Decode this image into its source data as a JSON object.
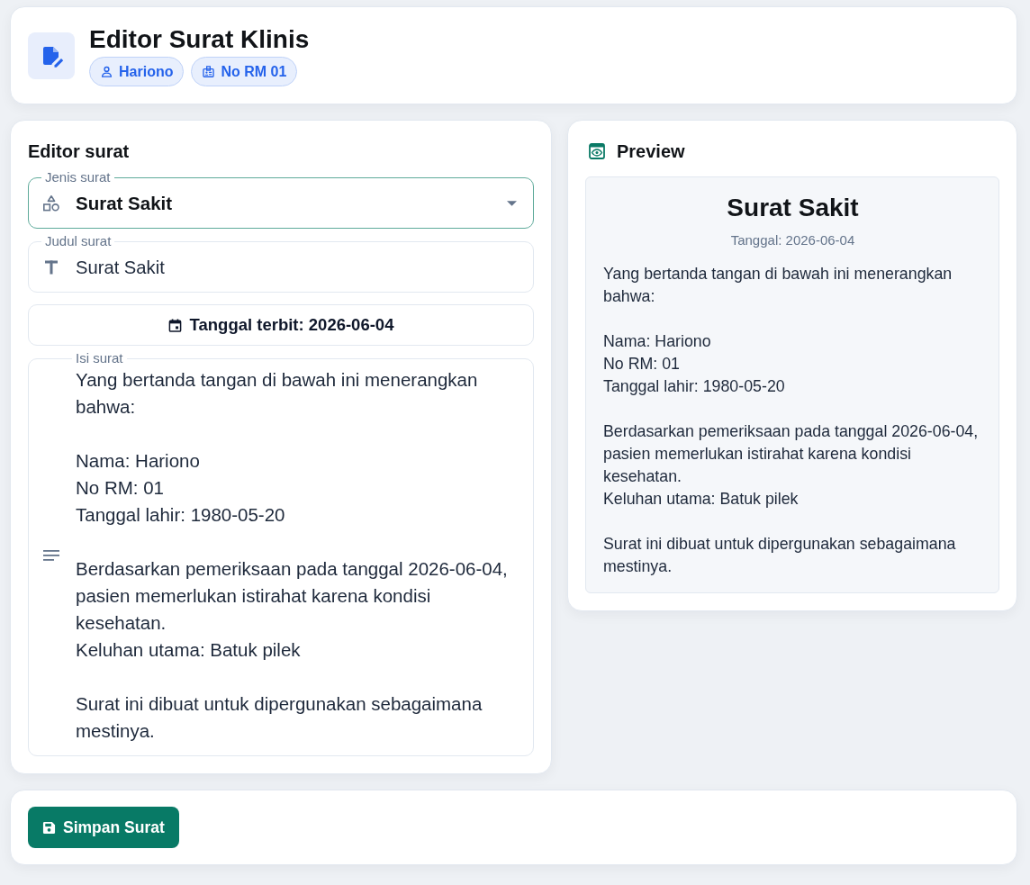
{
  "header": {
    "title": "Editor Surat Klinis",
    "chips": [
      {
        "kind": "patient",
        "label": "Hariono"
      },
      {
        "kind": "record",
        "label": "No RM 01"
      }
    ]
  },
  "editor": {
    "title": "Editor surat",
    "fields": [
      {
        "kind": "select",
        "label": "Jenis surat",
        "value": "Surat Sakit",
        "focused": true
      },
      {
        "kind": "text",
        "label": "Judul surat",
        "value": "Surat Sakit",
        "focused": false
      }
    ],
    "date_button": "Tanggal terbit: 2026-06-04",
    "body_field": {
      "label": "Isi surat",
      "value": "Yang bertanda tangan di bawah ini menerangkan bahwa:\n\nNama: Hariono\nNo RM: 01\nTanggal lahir: 1980-05-20\n\nBerdasarkan pemeriksaan pada tanggal 2026-06-04, pasien memerlukan istirahat karena kondisi kesehatan.\nKeluhan utama: Batuk pilek\n\nSurat ini dibuat untuk dipergunakan sebagaimana mestinya.",
      "focused": false
    }
  },
  "preview": {
    "title": "Preview",
    "letter_title": "Surat Sakit",
    "letter_date": "Tanggal: 2026-06-04",
    "letter_body": "Yang bertanda tangan di bawah ini menerangkan bahwa:\n\nNama: Hariono\nNo RM: 01\nTanggal lahir: 1980-05-20\n\nBerdasarkan pemeriksaan pada tanggal 2026-06-04, pasien memerlukan istirahat karena kondisi kesehatan.\nKeluhan utama: Batuk pilek\n\nSurat ini dibuat untuk dipergunakan sebagaimana mestinya."
  },
  "save_button": "Simpan Surat"
}
